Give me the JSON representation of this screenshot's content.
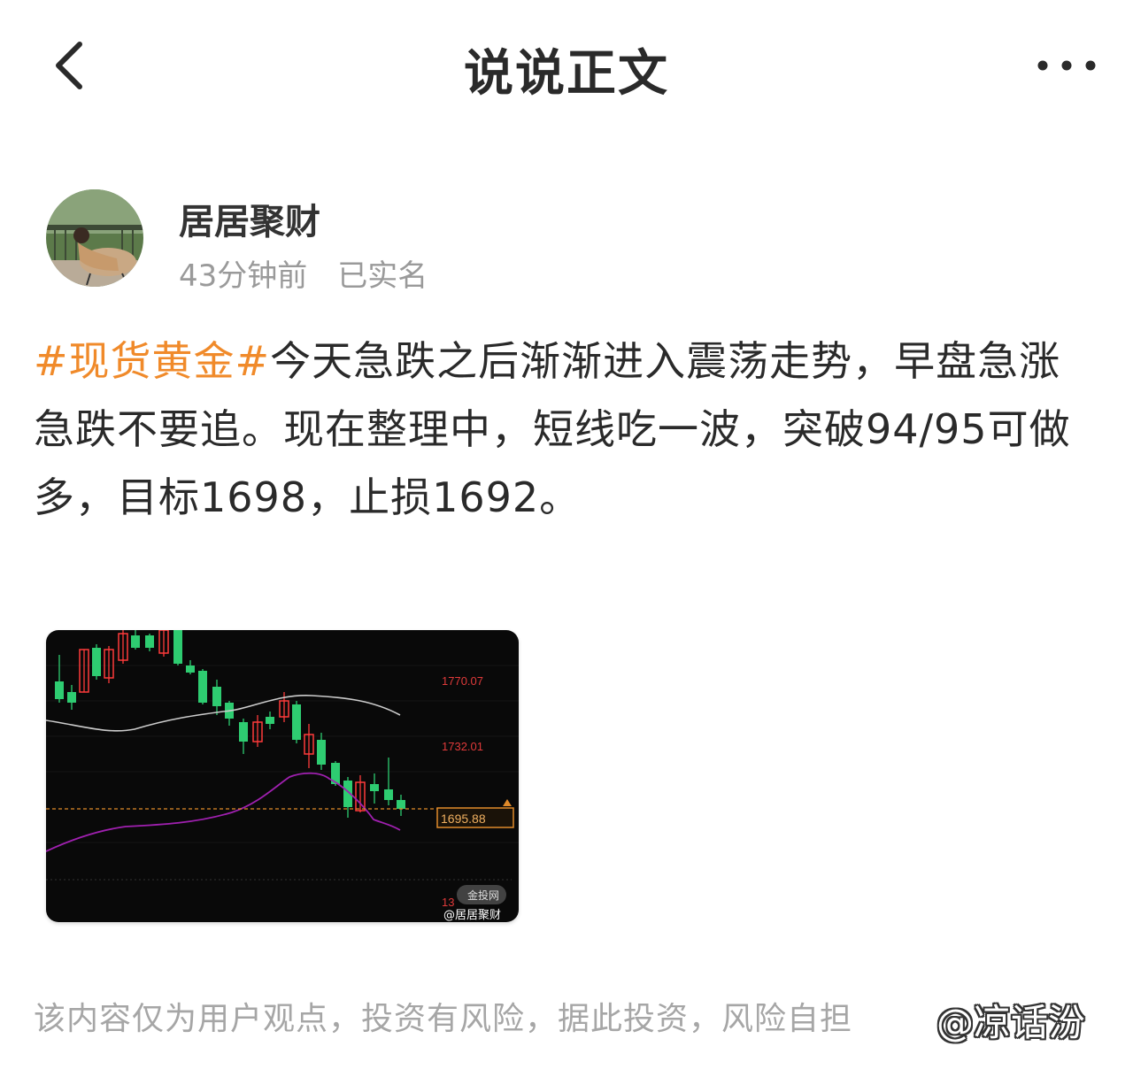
{
  "header": {
    "title": "说说正文",
    "back_icon": "chevron-left-icon",
    "more_icon": "more-dots-icon"
  },
  "author": {
    "name": "居居聚财",
    "time": "43分钟前",
    "verified_label": "已实名"
  },
  "post": {
    "hashtag": "#现货黄金#",
    "body": "今天急跌之后渐渐进入震荡走势，早盘急涨急跌不要追。现在整理中，短线吃一波，突破94/95可做多，目标1698，止损1692。"
  },
  "chart_data": {
    "type": "candlestick",
    "price_labels": [
      "1770.07",
      "1732.01",
      "1695.88"
    ],
    "current_price": "1695.88",
    "partial_label": "13",
    "source_badge": "金投网",
    "watermark": "@居居聚财",
    "colors": {
      "up": "#ff3b3b",
      "down": "#2ecc71",
      "ma_short": "#cccccc",
      "ma_long": "#a020b0",
      "price_line": "#e08a2a",
      "background": "#090909"
    }
  },
  "footer": {
    "disclaimer": "该内容仅为用户观点，投资有风险，据此投资，风险自担",
    "watermark": "@凉话汾"
  }
}
